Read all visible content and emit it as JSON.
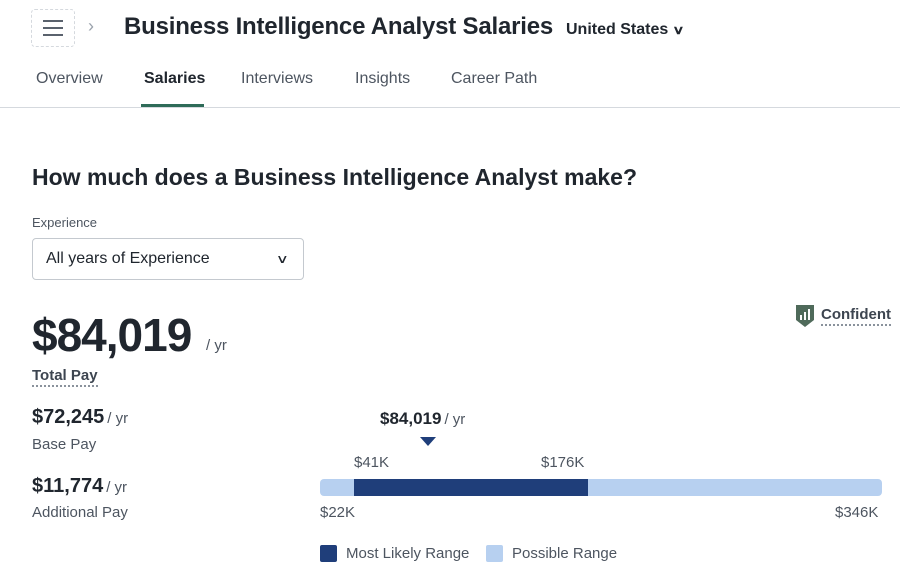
{
  "header": {
    "title": "Business Intelligence Analyst Salaries",
    "location": "United States"
  },
  "tabs": [
    {
      "label": "Overview"
    },
    {
      "label": "Salaries",
      "active": true
    },
    {
      "label": "Interviews"
    },
    {
      "label": "Insights"
    },
    {
      "label": "Career Path"
    }
  ],
  "main": {
    "question": "How much does a Business Intelligence Analyst make?",
    "experience": {
      "label": "Experience",
      "selected": "All years of Experience"
    },
    "confidence": "Confident",
    "total": {
      "amount": "$84,019",
      "unit": "/ yr",
      "label": "Total Pay"
    },
    "base": {
      "amount": "$72,245",
      "unit": "/ yr",
      "label": "Base Pay"
    },
    "additional": {
      "amount": "$11,774",
      "unit": "/ yr",
      "label": "Additional Pay"
    }
  },
  "range": {
    "median": "$84,019",
    "median_unit": "/ yr",
    "likely_low": "$41K",
    "likely_high": "$176K",
    "possible_low": "$22K",
    "possible_high": "$346K",
    "legend_likely": "Most Likely Range",
    "legend_possible": "Possible Range"
  },
  "colors": {
    "accent": "#2e6b58",
    "likely": "#1f3e7a",
    "possible": "#b7d0f0"
  }
}
